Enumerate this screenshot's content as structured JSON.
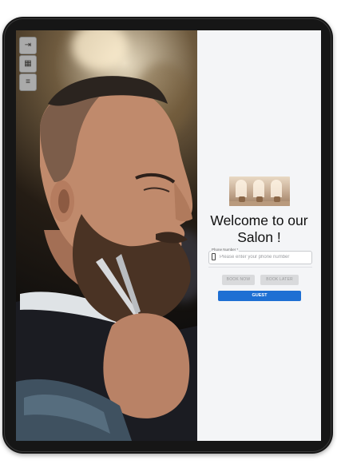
{
  "sidebar": {
    "buttons": [
      {
        "icon": "login-icon",
        "glyph": "⇥"
      },
      {
        "icon": "calendar-icon",
        "glyph": "▦"
      },
      {
        "icon": "menu-icon",
        "glyph": "≡"
      }
    ]
  },
  "welcome": {
    "line1": "Welcome to our",
    "line2": "Salon !"
  },
  "phone": {
    "label": "Phone Number *",
    "placeholder": "Please enter your phone number",
    "value": ""
  },
  "actions": {
    "book_now": "BOOK NOW",
    "book_later": "BOOK LATER",
    "guest": "GUEST"
  },
  "colors": {
    "primary": "#1e6fd3",
    "disabled": "#d9dadc",
    "panel_bg": "#f4f5f7",
    "device_frame": "#161616"
  }
}
